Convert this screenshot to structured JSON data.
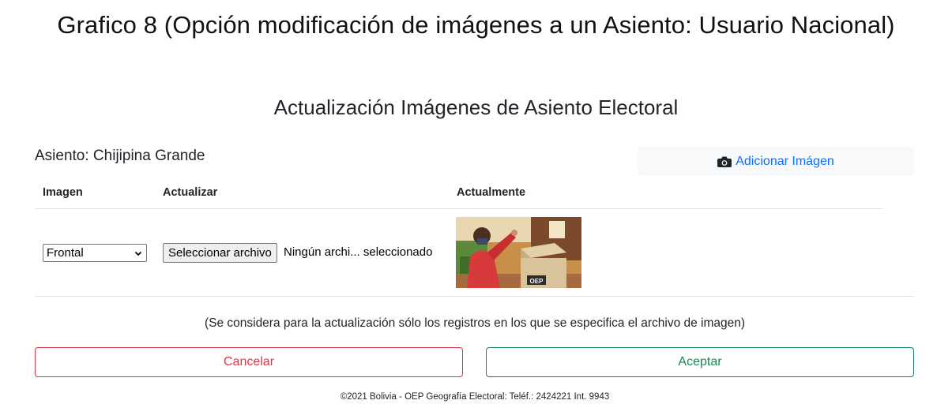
{
  "caption": "Grafico 8 (Opción modificación de imágenes a un Asiento: Usuario Nacional)",
  "panel": {
    "title": "Actualización Imágenes de Asiento Electoral",
    "asiento_heading": "Asiento: Chijipina Grande",
    "add_image_label": "Adicionar Imágen",
    "add_image_icon": "camera-icon"
  },
  "table": {
    "headers": [
      "Imagen",
      "Actualizar",
      "Actualmente"
    ],
    "rows": [
      {
        "image_type": "Frontal",
        "file_button_label": "Seleccionar archivo",
        "file_status": "Ningún archi... seleccionado",
        "current_image": "photo of voter at ballot box",
        "ballot_box_text": "OEP"
      }
    ]
  },
  "note": "(Se considera para la actualización sólo los registros en los que se especifica el archivo de imagen)",
  "buttons": {
    "cancel": "Cancelar",
    "accept": "Aceptar"
  },
  "colors": {
    "link": "#0d6efd",
    "danger": "#dc3545",
    "success": "#198754"
  },
  "footer": "©2021 Bolivia - OEP Geografía Electoral: Teléf.: 2424221 Int. 9943"
}
